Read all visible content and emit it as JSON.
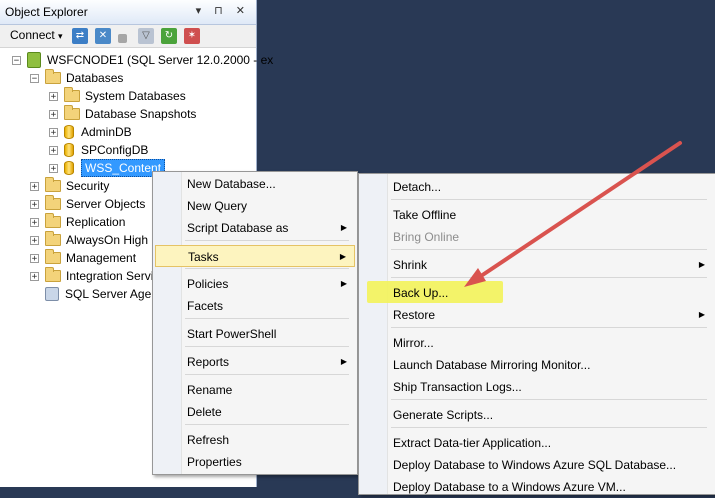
{
  "object_explorer": {
    "title": "Object Explorer",
    "title_controls": "▾ ⊓ ✕",
    "toolbar": {
      "connect_label": "Connect",
      "connect_arrow": "▾",
      "icons": [
        "connect-object-explorer-icon",
        "disconnect-icon",
        "stop-icon",
        "filter-icon",
        "refresh-icon",
        "activity-monitor-icon"
      ]
    },
    "tree": {
      "server": {
        "expander": "−",
        "label": "WSFCNODE1 (SQL Server 12.0.2000 - ex"
      },
      "databases": {
        "expander": "−",
        "label": "Databases"
      },
      "database_children": [
        {
          "expander": "+",
          "icon": "folder",
          "label": "System Databases"
        },
        {
          "expander": "+",
          "icon": "folder",
          "label": "Database Snapshots"
        },
        {
          "expander": "+",
          "icon": "database",
          "label": "AdminDB"
        },
        {
          "expander": "+",
          "icon": "database",
          "label": "SPConfigDB"
        },
        {
          "expander": "+",
          "icon": "database",
          "label": "WSS_Content"
        }
      ],
      "server_children": [
        {
          "expander": "+",
          "icon": "folder",
          "label": "Security"
        },
        {
          "expander": "+",
          "icon": "folder",
          "label": "Server Objects"
        },
        {
          "expander": "+",
          "icon": "folder",
          "label": "Replication"
        },
        {
          "expander": "+",
          "icon": "folder",
          "label": "AlwaysOn High"
        },
        {
          "expander": "+",
          "icon": "folder",
          "label": "Management"
        },
        {
          "expander": "+",
          "icon": "folder",
          "label": "Integration Servi"
        },
        {
          "expander": "",
          "icon": "agent",
          "label": "SQL Server Ager"
        }
      ]
    }
  },
  "context_menu": {
    "items": [
      {
        "label": "New Database...",
        "submenu": false
      },
      {
        "label": "New Query",
        "submenu": false
      },
      {
        "label": "Script Database as",
        "submenu": true
      },
      {
        "label": "Tasks",
        "submenu": true,
        "hot": true
      },
      {
        "label": "Policies",
        "submenu": true
      },
      {
        "label": "Facets",
        "submenu": false
      },
      {
        "label": "Start PowerShell",
        "submenu": false
      },
      {
        "label": "Reports",
        "submenu": true
      },
      {
        "label": "Rename",
        "submenu": false
      },
      {
        "label": "Delete",
        "submenu": false
      },
      {
        "label": "Refresh",
        "submenu": false
      },
      {
        "label": "Properties",
        "submenu": false
      }
    ],
    "arrow_glyph": "▶"
  },
  "tasks_menu": {
    "items": [
      {
        "label": "Detach...",
        "submenu": false
      },
      {
        "label": "Take Offline",
        "submenu": false
      },
      {
        "label": "Bring Online",
        "submenu": false,
        "disabled": true
      },
      {
        "label": "Shrink",
        "submenu": true
      },
      {
        "label": "Back Up...",
        "submenu": false,
        "highlighted": true
      },
      {
        "label": "Restore",
        "submenu": true
      },
      {
        "label": "Mirror...",
        "submenu": false
      },
      {
        "label": "Launch Database Mirroring Monitor...",
        "submenu": false
      },
      {
        "label": "Ship Transaction Logs...",
        "submenu": false
      },
      {
        "label": "Generate Scripts...",
        "submenu": false
      },
      {
        "label": "Extract Data-tier Application...",
        "submenu": false
      },
      {
        "label": "Deploy Database to Windows Azure SQL Database...",
        "submenu": false
      },
      {
        "label": "Deploy Database to a Windows Azure VM...",
        "submenu": false
      }
    ],
    "arrow_glyph": "▶"
  },
  "colors": {
    "annotation_arrow": "#d9534f",
    "highlight": "#f3f35a",
    "background": "#293955"
  }
}
